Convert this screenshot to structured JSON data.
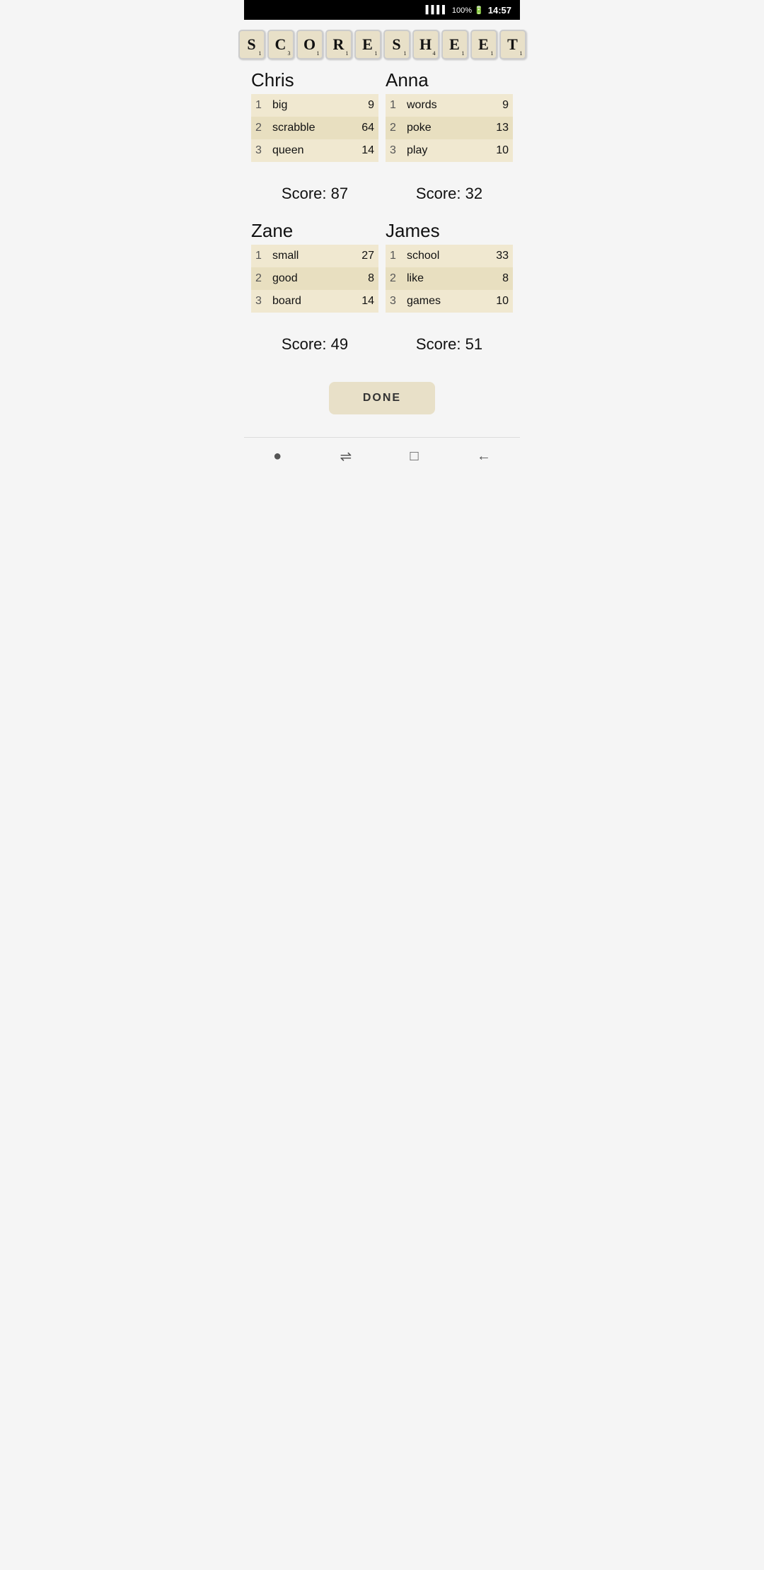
{
  "statusBar": {
    "signal": "▌▌▌▌",
    "battery": "100% 🔋",
    "time": "14:57"
  },
  "title": {
    "letters": [
      {
        "char": "S",
        "num": "1"
      },
      {
        "char": "C",
        "num": "3"
      },
      {
        "char": "O",
        "num": "1"
      },
      {
        "char": "R",
        "num": "1"
      },
      {
        "char": "E",
        "num": "1"
      },
      {
        "char": "S",
        "num": "1"
      },
      {
        "char": "H",
        "num": "4"
      },
      {
        "char": "E",
        "num": "1"
      },
      {
        "char": "E",
        "num": "1"
      },
      {
        "char": "T",
        "num": "1"
      }
    ]
  },
  "players": [
    {
      "name": "Chris",
      "moves": [
        {
          "turn": 1,
          "word": "big",
          "score": 9
        },
        {
          "turn": 2,
          "word": "scrabble",
          "score": 64
        },
        {
          "turn": 3,
          "word": "queen",
          "score": 14
        }
      ],
      "total": "Score: 87"
    },
    {
      "name": "Anna",
      "moves": [
        {
          "turn": 1,
          "word": "words",
          "score": 9
        },
        {
          "turn": 2,
          "word": "poke",
          "score": 13
        },
        {
          "turn": 3,
          "word": "play",
          "score": 10
        }
      ],
      "total": "Score: 32"
    },
    {
      "name": "Zane",
      "moves": [
        {
          "turn": 1,
          "word": "small",
          "score": 27
        },
        {
          "turn": 2,
          "word": "good",
          "score": 8
        },
        {
          "turn": 3,
          "word": "board",
          "score": 14
        }
      ],
      "total": "Score: 49"
    },
    {
      "name": "James",
      "moves": [
        {
          "turn": 1,
          "word": "school",
          "score": 33
        },
        {
          "turn": 2,
          "word": "like",
          "score": 8
        },
        {
          "turn": 3,
          "word": "games",
          "score": 10
        }
      ],
      "total": "Score: 51"
    }
  ],
  "doneButton": "DONE",
  "nav": {
    "dot": "●",
    "menu": "⇌",
    "square": "□",
    "back": "←"
  }
}
